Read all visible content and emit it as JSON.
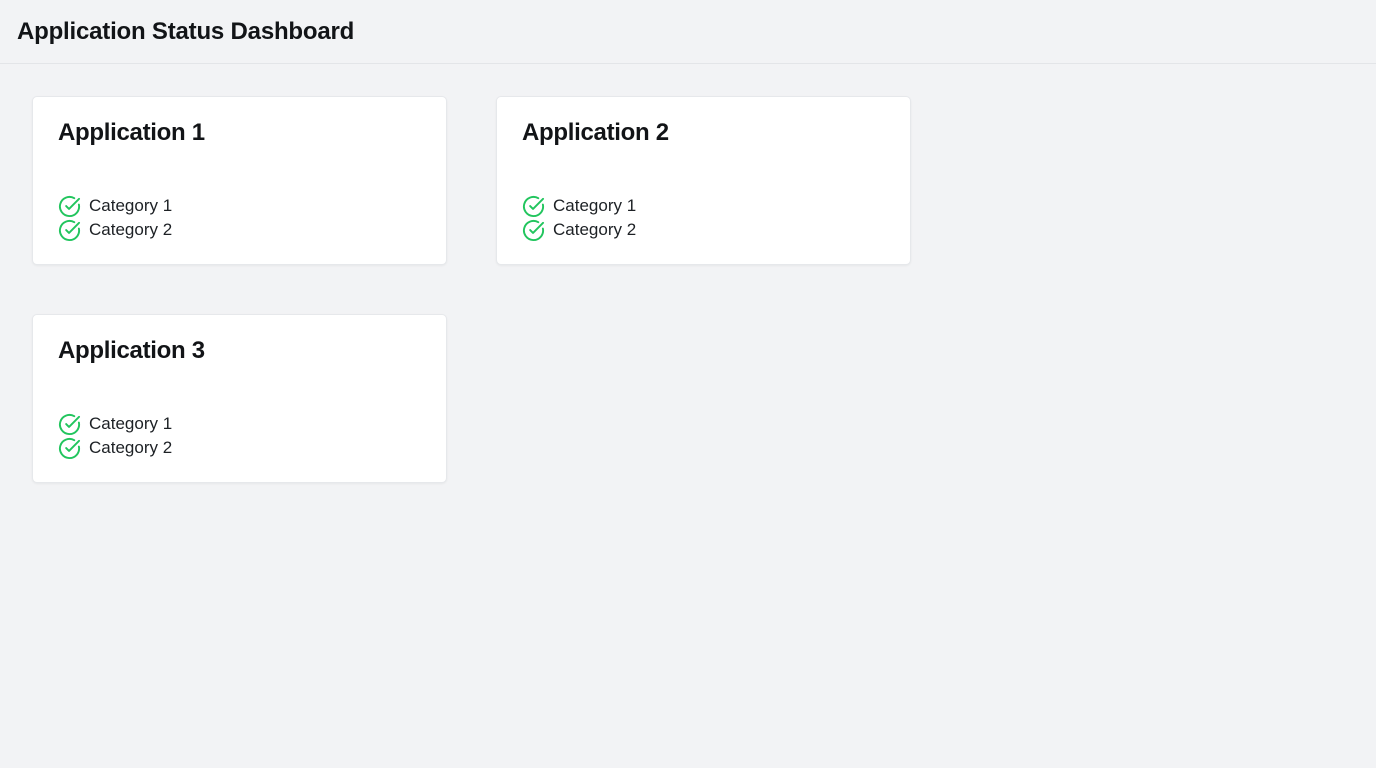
{
  "header": {
    "title": "Application Status Dashboard"
  },
  "colors": {
    "status_ok": "#22c55e",
    "background": "#f2f3f5",
    "card": "#ffffff"
  },
  "applications": [
    {
      "name": "Application 1",
      "categories": [
        {
          "label": "Category 1",
          "status_icon": "check-circle-icon"
        },
        {
          "label": "Category 2",
          "status_icon": "check-circle-icon"
        }
      ]
    },
    {
      "name": "Application 2",
      "categories": [
        {
          "label": "Category 1",
          "status_icon": "check-circle-icon"
        },
        {
          "label": "Category 2",
          "status_icon": "check-circle-icon"
        }
      ]
    },
    {
      "name": "Application 3",
      "categories": [
        {
          "label": "Category 1",
          "status_icon": "check-circle-icon"
        },
        {
          "label": "Category 2",
          "status_icon": "check-circle-icon"
        }
      ]
    }
  ]
}
